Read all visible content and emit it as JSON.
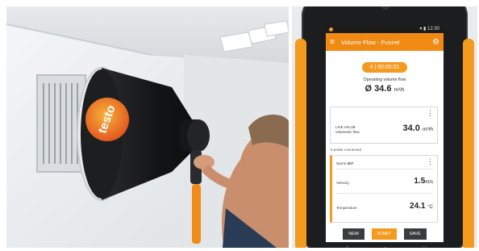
{
  "photo": {
    "brand_logo": "testo"
  },
  "device": {
    "status_time": "12:30",
    "app_title": "Volume Flow - Funnel",
    "icons": {
      "menu": "menu-icon",
      "settings": "gear-icon",
      "kebab": "kebab-icon"
    },
    "timer": "4 | 00:00:01",
    "operating_label": "Operating volume flow",
    "operating_value": "Ø 34.6",
    "operating_unit": "m³/h",
    "live": {
      "label_line1": "LIVE VALUE",
      "label_line2": "Volumetric flow",
      "value": "34.0",
      "unit": "m³/h"
    },
    "probes_connected": "5 probe connected",
    "probe": {
      "name_label": "Name",
      "name_value": "407",
      "velocity_label": "Velocity",
      "velocity_value": "1.5",
      "velocity_unit": "m/s",
      "temperature_label": "Temperature",
      "temperature_value": "24.1",
      "temperature_unit": "°C"
    },
    "buttons": {
      "new": "NEW",
      "start": "START",
      "save": "SAVE"
    },
    "nav": {
      "back": "◁",
      "home": "○",
      "recent": "□"
    },
    "colors": {
      "accent": "#f39a1f",
      "appbar": "#f18a13",
      "dark_button": "#3a3b3d"
    }
  }
}
